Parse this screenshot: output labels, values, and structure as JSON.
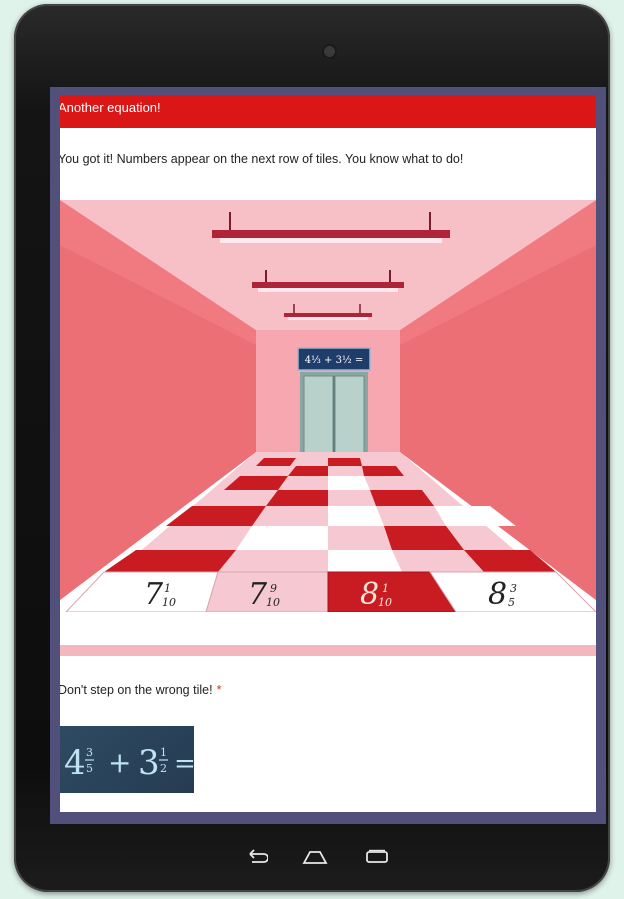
{
  "header": {
    "title": "Another equation!"
  },
  "intro": {
    "text": "You got it! Numbers appear on the next row of tiles. You know what to do!"
  },
  "scene": {
    "elevator_sign": "4⅓ + 3½ =",
    "tiles": [
      {
        "whole": "7",
        "num": "1",
        "den": "10"
      },
      {
        "whole": "7",
        "num": "9",
        "den": "10"
      },
      {
        "whole": "8",
        "num": "1",
        "den": "10"
      },
      {
        "whole": "8",
        "num": "3",
        "den": "5"
      }
    ]
  },
  "question": {
    "label": "Don't step on the wrong tile!",
    "required_marker": "*"
  },
  "equation": {
    "a_whole": "4",
    "a_num": "3",
    "a_den": "5",
    "op": "+",
    "b_whole": "3",
    "b_num": "1",
    "b_den": "2",
    "equals": "="
  },
  "colors": {
    "header": "#db1616",
    "wall": "#f07a80",
    "tile_red": "#c91c22",
    "tile_pink": "#f6c8d2",
    "tile_white": "#ffffff"
  },
  "icons": [
    "back-icon",
    "home-icon",
    "recents-icon",
    "camera-icon"
  ]
}
